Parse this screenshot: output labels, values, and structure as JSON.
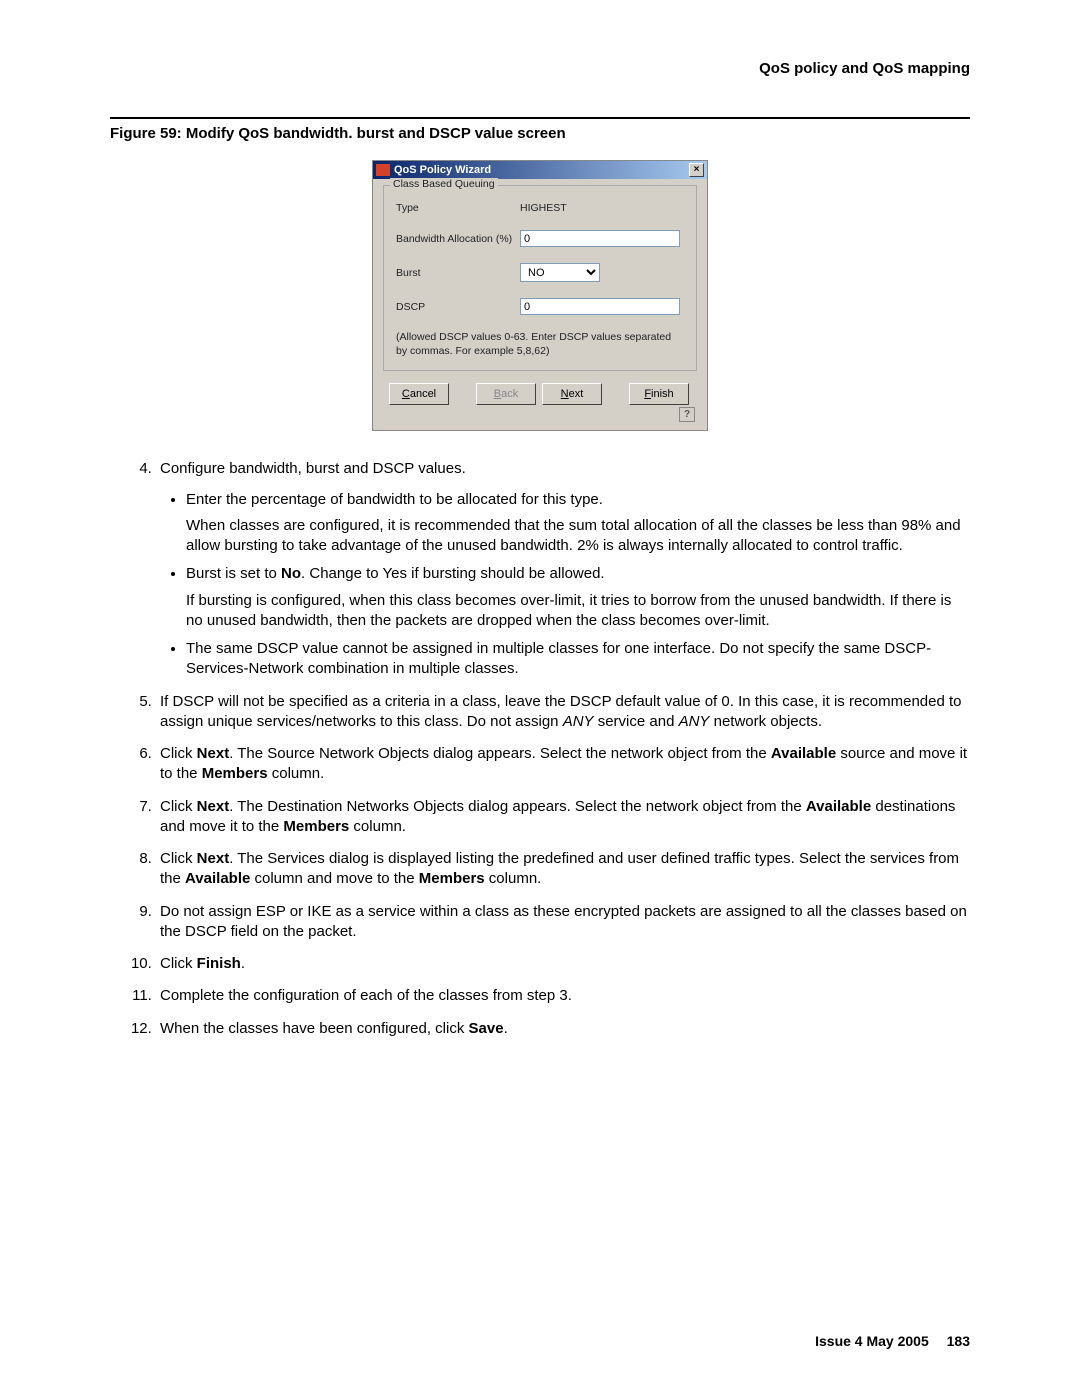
{
  "header": {
    "section": "QoS policy and QoS mapping"
  },
  "figure": {
    "caption": "Figure 59: Modify QoS bandwidth. burst and DSCP value screen"
  },
  "wizard": {
    "title": "QoS Policy Wizard",
    "fieldset_legend": "Class Based Queuing",
    "type_label": "Type",
    "type_value": "HIGHEST",
    "bw_label": "Bandwidth Allocation (%)",
    "bw_value": "0",
    "burst_label": "Burst",
    "burst_value": "NO",
    "dscp_label": "DSCP",
    "dscp_value": "0",
    "hint": "(Allowed DSCP values 0-63. Enter DSCP values separated by commas. For example 5,8,62)",
    "buttons": {
      "cancel": "Cancel",
      "cancel_u": "C",
      "back": "Back",
      "back_u": "B",
      "next": "Next",
      "next_u": "N",
      "finish": "Finish",
      "finish_u": "F"
    },
    "help": "?"
  },
  "steps": {
    "s4": {
      "lead": "Configure bandwidth, burst and DSCP values.",
      "b1": "Enter the percentage of bandwidth to be allocated for this type.",
      "b1p": "When classes are configured, it is recommended that the sum total allocation of all the classes be less than 98% and allow bursting to take advantage of the unused bandwidth. 2% is always internally allocated to control traffic.",
      "b2a": "Burst is set to ",
      "b2b": "No",
      "b2c": ". Change to Yes if bursting should be allowed.",
      "b2p": "If bursting is configured, when this class becomes over-limit, it tries to borrow from the unused bandwidth. If there is no unused bandwidth, then the packets are dropped when the class becomes over-limit.",
      "b3": "The same DSCP value cannot be assigned in multiple classes for one interface. Do not specify the same DSCP-Services-Network combination in multiple classes."
    },
    "s5a": "If DSCP will not be specified as a criteria in a class, leave the DSCP default value of 0. In this case, it is recommended to assign unique services/networks to this class. Do not assign ",
    "s5b": "ANY",
    "s5c": " service and ",
    "s5d": "ANY",
    "s5e": " network objects.",
    "s6a": "Click ",
    "s6b": "Next",
    "s6c": ". The Source Network Objects dialog appears. Select the network object from the ",
    "s6d": "Available",
    "s6e": " source and move it to the ",
    "s6f": "Members",
    "s6g": " column.",
    "s7a": "Click ",
    "s7b": "Next",
    "s7c": ". The Destination Networks Objects dialog appears. Select the network object from the ",
    "s7d": "Available",
    "s7e": " destinations and move it to the ",
    "s7f": "Members",
    "s7g": " column.",
    "s8a": "Click ",
    "s8b": "Next",
    "s8c": ". The Services dialog is displayed listing the predefined and user defined traffic types. Select the services from the ",
    "s8d": "Available",
    "s8e": " column and move to the ",
    "s8f": "Members",
    "s8g": " column.",
    "s9": "Do not assign ESP or IKE as a service within a class as these encrypted packets are assigned to all the classes based on the DSCP field on the packet.",
    "s10a": "Click ",
    "s10b": "Finish",
    "s10c": ".",
    "s11": "Complete the configuration of each of the classes from step 3.",
    "s12a": "When the classes have been configured, click ",
    "s12b": "Save",
    "s12c": "."
  },
  "footer": {
    "issue": "Issue 4   May 2005",
    "page": "183"
  }
}
